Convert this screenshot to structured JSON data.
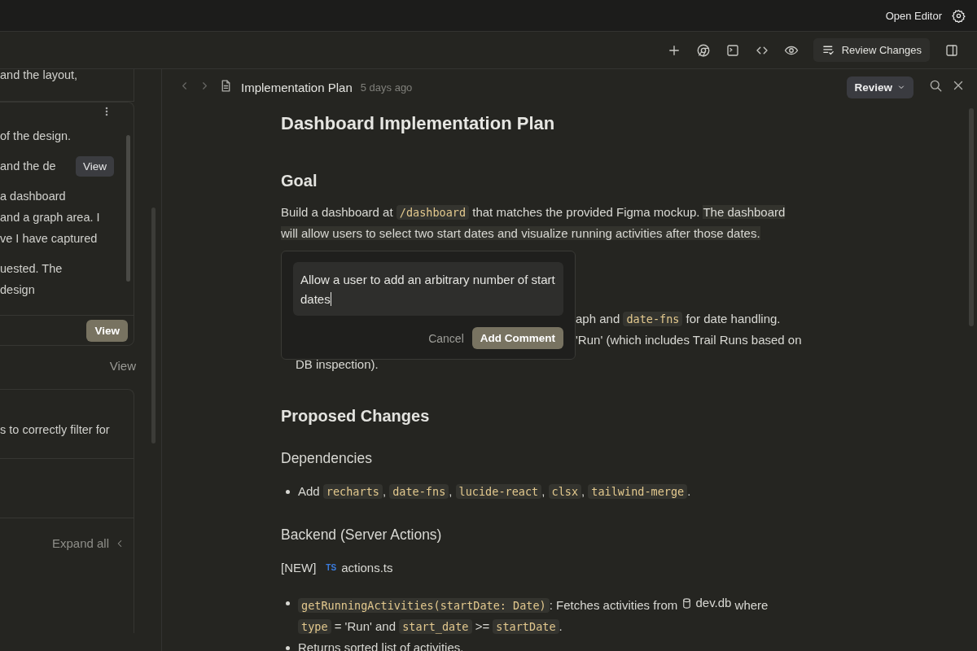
{
  "top_bar": {
    "open_editor": "Open Editor"
  },
  "toolbar": {
    "review_changes": "Review Changes"
  },
  "side_panel": {
    "cards": [
      {
        "kind": "fragment",
        "paragraphs": [
          [
            {
              "text": "and the layout,"
            }
          ]
        ]
      },
      {
        "kind": "scroll",
        "paragraphs": [
          [
            {
              "text": "of the design."
            }
          ],
          [
            {
              "text": "and the de",
              "button": "View"
            }
          ],
          [
            {
              "text": "a dashboard"
            },
            {
              "text": " and a graph area. I"
            },
            {
              "text": "ve I have captured"
            }
          ],
          [
            {
              "text": "uested. The"
            },
            {
              "text": "design"
            }
          ]
        ],
        "footer_button": "View"
      },
      {
        "kind": "link",
        "text": "View"
      },
      {
        "kind": "task",
        "paragraphs": [
          [
            {
              "text": "s to correctly filter for"
            }
          ]
        ],
        "expand": "Expand all"
      }
    ]
  },
  "document_header": {
    "title": "Implementation Plan",
    "time": "5 days ago",
    "review": "Review"
  },
  "document": [
    {
      "kind": "h1",
      "text": "Dashboard Implementation Plan"
    },
    {
      "kind": "h2",
      "text": "Goal"
    },
    {
      "kind": "p",
      "lines": [
        [
          {
            "kind": "text",
            "text": "Build a dashboard at "
          },
          {
            "kind": "code",
            "text": "/dashboard"
          },
          {
            "kind": "text",
            "text": " that matches the provided Figma mockup. "
          },
          {
            "kind": "highlight",
            "text": "The dashboard"
          }
        ],
        [
          {
            "kind": "highlight",
            "text": "will allow users to select two start dates and visualize running activities after those dates."
          }
        ]
      ]
    },
    {
      "kind": "covered",
      "lines": [
        {
          "kind": "beside",
          "segments": [
            {
              "kind": "text",
              "text": "aph and "
            },
            {
              "kind": "code",
              "text": "date-fns"
            },
            {
              "kind": "text",
              "text": " for date handling."
            }
          ]
        },
        {
          "kind": "beside",
          "segments": [
            {
              "kind": "text",
              "text": "'Run' (which includes Trail Runs based on"
            }
          ]
        },
        {
          "kind": "below",
          "segments": [
            {
              "kind": "text",
              "text": "DB inspection)."
            }
          ]
        }
      ]
    },
    {
      "kind": "h2",
      "text": "Proposed Changes"
    },
    {
      "kind": "h3",
      "text": "Dependencies"
    },
    {
      "kind": "bullet",
      "lines": [
        [
          {
            "kind": "text",
            "text": "Add "
          },
          {
            "kind": "code",
            "text": "recharts"
          },
          {
            "kind": "text",
            "text": ", "
          },
          {
            "kind": "code",
            "text": "date-fns"
          },
          {
            "kind": "text",
            "text": ", "
          },
          {
            "kind": "code",
            "text": "lucide-react"
          },
          {
            "kind": "text",
            "text": ", "
          },
          {
            "kind": "code",
            "text": "clsx"
          },
          {
            "kind": "text",
            "text": ", "
          },
          {
            "kind": "code",
            "text": "tailwind-merge"
          },
          {
            "kind": "text",
            "text": "."
          }
        ]
      ]
    },
    {
      "kind": "h3",
      "text": "Backend (Server Actions)"
    },
    {
      "kind": "file",
      "tag": "[NEW]",
      "badge": "TS",
      "name": "actions.ts"
    },
    {
      "kind": "bullet",
      "lines": [
        [
          {
            "kind": "code",
            "text": "getRunningActivities(startDate: Date)"
          },
          {
            "kind": "text",
            "text": ": Fetches activities from "
          },
          {
            "kind": "db",
            "text": "dev.db"
          },
          {
            "kind": "text",
            "text": " where"
          }
        ],
        [
          {
            "kind": "code",
            "text": "type"
          },
          {
            "kind": "text",
            "text": " = 'Run' and "
          },
          {
            "kind": "code",
            "text": "start_date"
          },
          {
            "kind": "text",
            "text": " >= "
          },
          {
            "kind": "code",
            "text": "startDate"
          },
          {
            "kind": "text",
            "text": "."
          }
        ]
      ]
    },
    {
      "kind": "bullet",
      "lines": [
        [
          {
            "kind": "text",
            "text": "Returns sorted list of activities."
          }
        ]
      ]
    }
  ],
  "comment_box": {
    "value": "Allow a user to add an arbitrary number of start dates",
    "cancel": "Cancel",
    "submit": "Add Comment"
  }
}
